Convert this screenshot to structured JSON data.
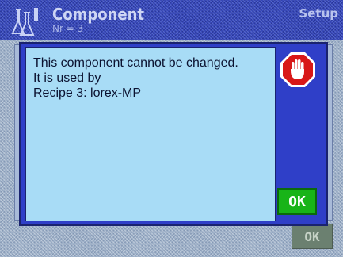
{
  "header": {
    "title": "Component",
    "subtitle": "Nr = 3",
    "setup_label": "Setup",
    "app_icon": "flask-icon"
  },
  "background": {
    "ok_label": "OK"
  },
  "dialog": {
    "lines": [
      "This component cannot be changed.",
      "It is used by",
      "Recipe 3: lorex-MP"
    ],
    "icon": "stop-hand-icon",
    "ok_label": "OK"
  },
  "colors": {
    "header_bg": "#3848b8",
    "dialog_frame": "#2f3fc8",
    "dialog_text_bg": "#a8dcf6",
    "ok_button": "#18b418",
    "stop_red": "#d81818"
  }
}
